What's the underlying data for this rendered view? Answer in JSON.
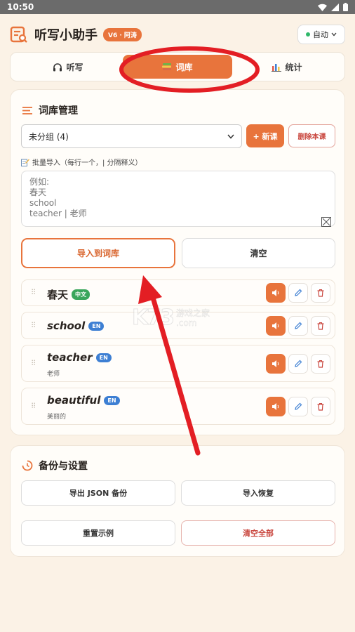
{
  "status_bar": {
    "time": "10:50"
  },
  "header": {
    "title": "听写小助手",
    "version_badge": "V6 · 阿涛",
    "theme": "自动"
  },
  "tabs": [
    {
      "label": "听写",
      "icon": "headphones-icon"
    },
    {
      "label": "词库",
      "icon": "books-icon",
      "active": true
    },
    {
      "label": "统计",
      "icon": "bar-chart-icon"
    }
  ],
  "library": {
    "title": "词库管理",
    "group_select": "未分组 (4)",
    "new_lesson": "+ 新课",
    "delete_lesson": "删除本课",
    "batch_label": "批量导入（每行一个，| 分隔释义）",
    "textarea_placeholder": "例如:\n春天\nschool\nteacher | 老师",
    "import_button": "导入到词库",
    "clear_button": "清空",
    "words": [
      {
        "word": "春天",
        "badge": "中文",
        "lang": "zh",
        "meaning": ""
      },
      {
        "word": "school",
        "badge": "EN",
        "lang": "en",
        "meaning": ""
      },
      {
        "word": "teacher",
        "badge": "EN",
        "lang": "en",
        "meaning": "老师"
      },
      {
        "word": "beautiful",
        "badge": "EN",
        "lang": "en",
        "meaning": "美丽的"
      }
    ]
  },
  "backup": {
    "title": "备份与设置",
    "export_json": "导出 JSON 备份",
    "import_restore": "导入恢复",
    "reset_example": "重置示例",
    "clear_all": "清空全部"
  },
  "watermark": {
    "logo": "K73",
    "line1": "游戏之家",
    "line2": ".com"
  },
  "colors": {
    "accent": "#e8743c",
    "annotation": "#e31e24",
    "background": "#fbf2e6"
  }
}
